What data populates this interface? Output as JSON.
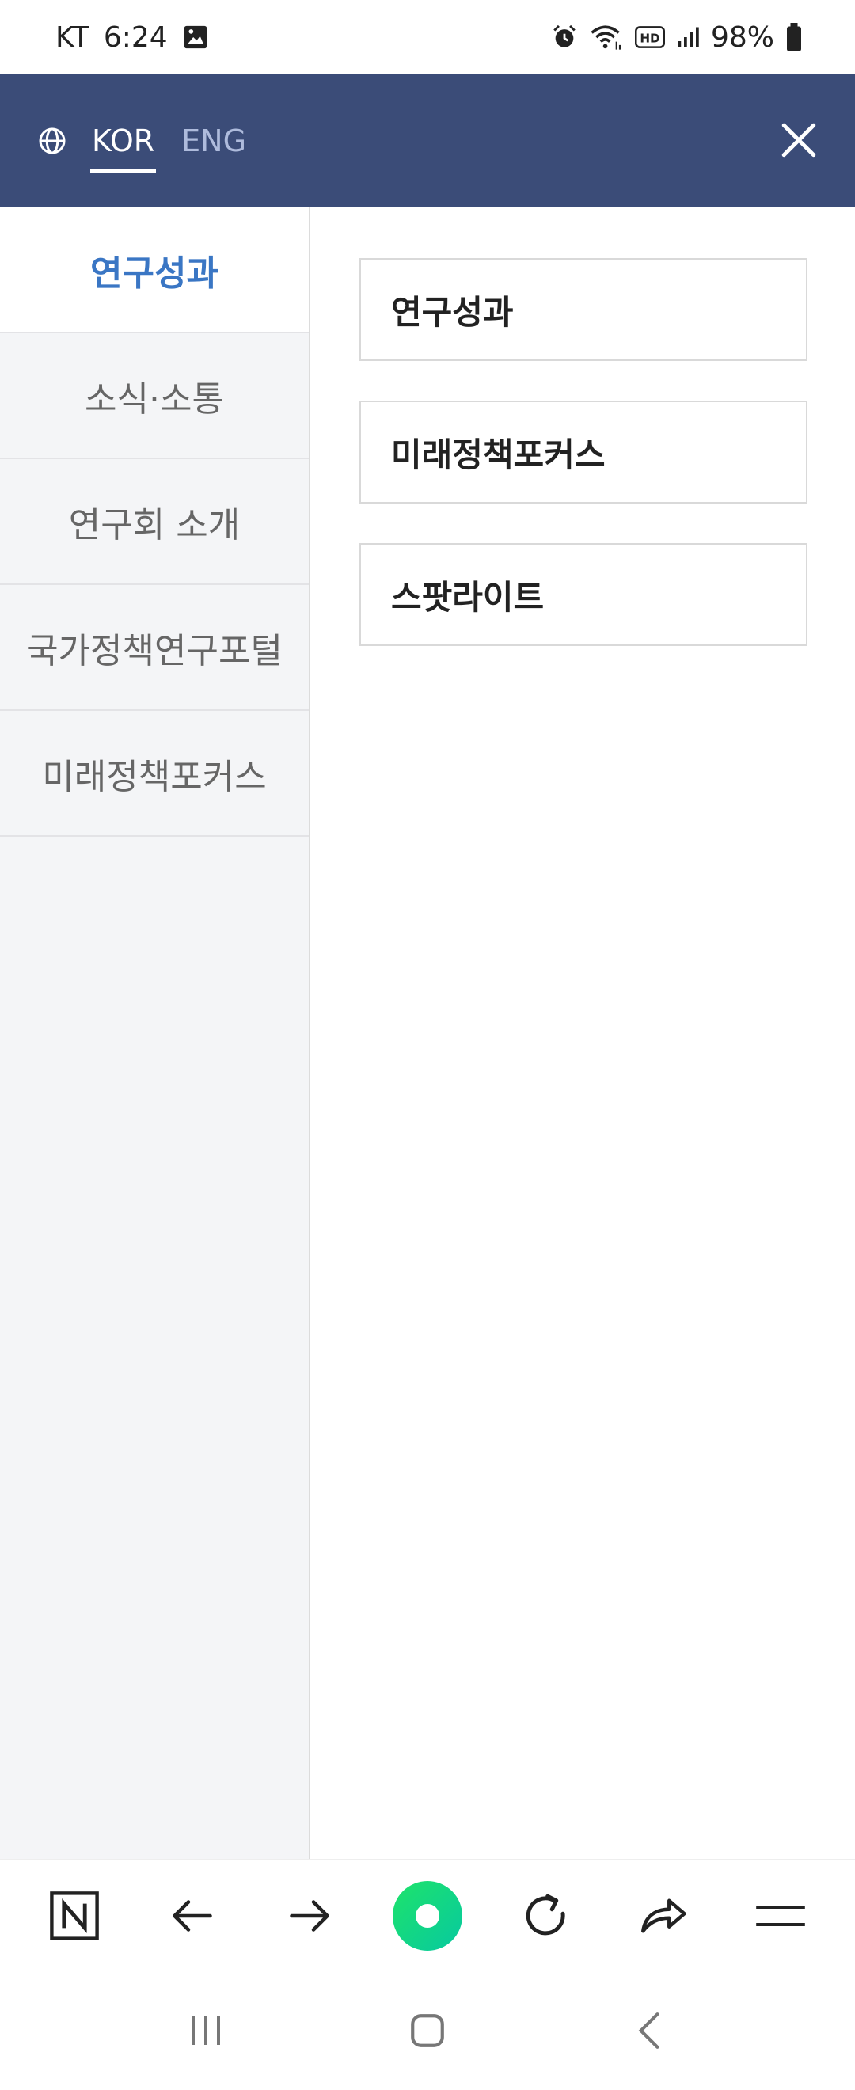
{
  "status_bar": {
    "carrier": "KT",
    "time": "6:24",
    "battery": "98%"
  },
  "header": {
    "lang_tabs": [
      {
        "label": "KOR",
        "active": true
      },
      {
        "label": "ENG",
        "active": false
      }
    ],
    "colors": {
      "background": "#3b4c78",
      "active": "#ffffff",
      "inactive": "#aebbdc"
    }
  },
  "left_menu": {
    "items": [
      {
        "label": "연구성과",
        "active": true
      },
      {
        "label": "소식·소통",
        "active": false
      },
      {
        "label": "연구회 소개",
        "active": false
      },
      {
        "label": "국가정책연구포털",
        "active": false
      },
      {
        "label": "미래정책포커스",
        "active": false
      }
    ],
    "active_color": "#3a76c4"
  },
  "right_panel": {
    "items": [
      {
        "label": "연구성과"
      },
      {
        "label": "미래정책포커스"
      },
      {
        "label": "스팟라이트"
      }
    ]
  },
  "browser_toolbar": {
    "icons": [
      "naver-n-icon",
      "back-arrow-icon",
      "forward-arrow-icon",
      "green-dot-icon",
      "refresh-icon",
      "share-icon",
      "menu-icon"
    ]
  },
  "system_nav": {
    "icons": [
      "recent-apps-icon",
      "home-icon",
      "back-icon"
    ]
  }
}
